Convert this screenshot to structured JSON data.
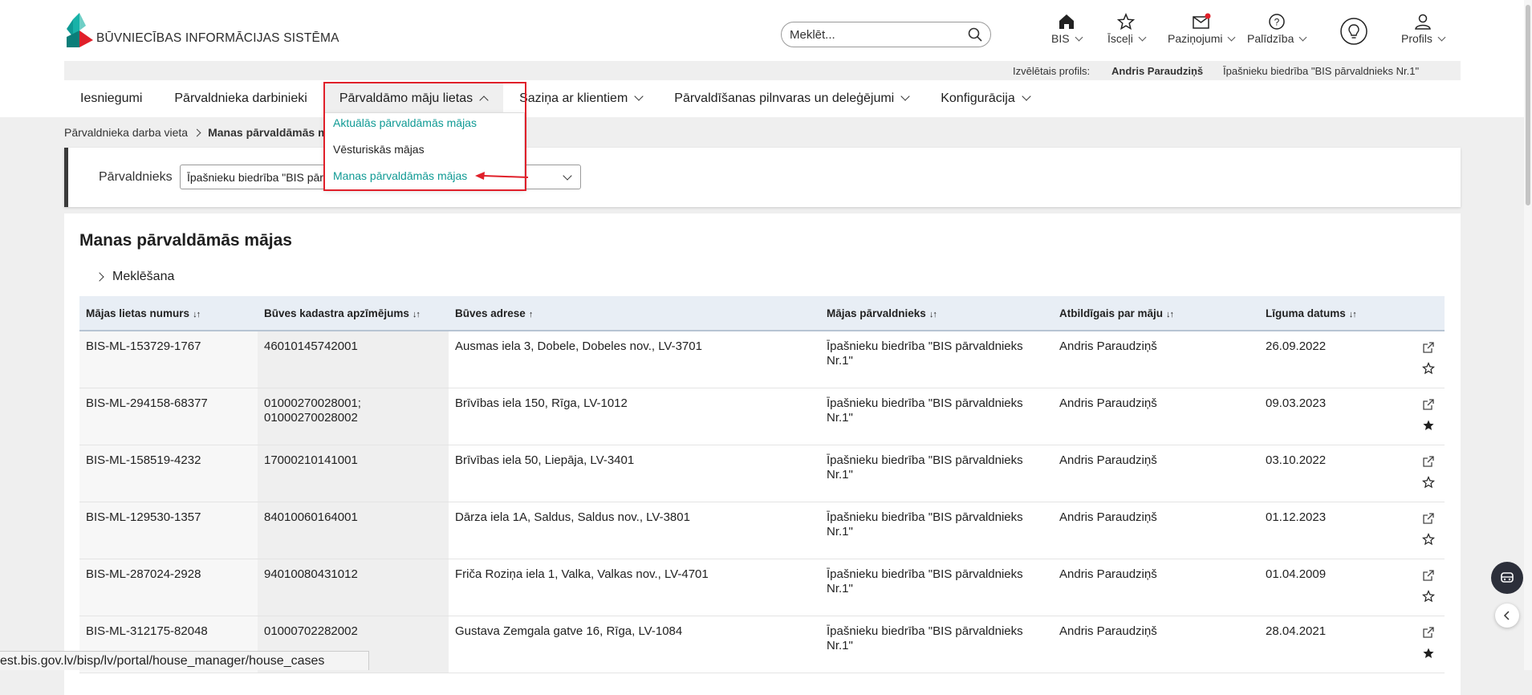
{
  "header": {
    "logo_text": "BŪVNIECĪBAS INFORMĀCIJAS SISTĒMA",
    "search_placeholder": "Meklēt...",
    "icons": [
      {
        "label": "BIS",
        "icon": "home-icon"
      },
      {
        "label": "Īsceļi",
        "icon": "star-icon"
      },
      {
        "label": "Paziņojumi",
        "icon": "envelope-icon"
      },
      {
        "label": "Palīdzība",
        "icon": "question-icon"
      },
      {
        "label": "",
        "icon": "lightbulb-icon"
      },
      {
        "label": "Profils",
        "icon": "user-icon"
      }
    ]
  },
  "profile_bar": {
    "label": "Izvēlētais profils:",
    "name": "Andris Paraudziņš",
    "org": "Īpašnieku biedrība \"BIS pārvaldnieks Nr.1\""
  },
  "nav": {
    "items": [
      "Iesniegumi",
      "Pārvaldnieka darbinieki",
      "Pārvaldāmo māju lietas",
      "Saziņa ar klientiem",
      "Pārvaldīšanas pilnvaras un deleģējumi",
      "Konfigurācija"
    ],
    "dropdown": [
      "Aktuālās pārvaldāmās mājas",
      "Vēsturiskās mājas",
      "Manas pārvaldāmās mājas"
    ]
  },
  "breadcrumb": {
    "parent": "Pārvaldnieka darba vieta",
    "current": "Manas pārvaldāmās m"
  },
  "filter": {
    "label": "Pārvaldnieks",
    "value": "Īpašnieku biedrība \"BIS pārv"
  },
  "main": {
    "title": "Manas pārvaldāmās mājas",
    "search_toggle": "Meklēšana",
    "columns": [
      "Mājas lietas numurs",
      "Būves kadastra apzīmējums",
      "Būves adrese",
      "Mājas pārvaldnieks",
      "Atbildīgais par māju",
      "Līguma datums"
    ],
    "column_sort": [
      "↓↑",
      "↓↑",
      "↑",
      "↓↑",
      "↓↑",
      "↓↑"
    ],
    "rows": [
      {
        "num": "BIS-ML-153729-1767",
        "kad": "46010145742001",
        "addr": "Ausmas iela 3, Dobele, Dobeles nov., LV-3701",
        "mgr": "Īpašnieku biedrība \"BIS pārvaldnieks Nr.1\"",
        "resp": "Andris Paraudziņš",
        "date": "26.09.2022",
        "fav": false
      },
      {
        "num": "BIS-ML-294158-68377",
        "kad": "01000270028001;\n01000270028002",
        "addr": "Brīvības iela 150, Rīga, LV-1012",
        "mgr": "Īpašnieku biedrība \"BIS pārvaldnieks Nr.1\"",
        "resp": "Andris Paraudziņš",
        "date": "09.03.2023",
        "fav": true
      },
      {
        "num": "BIS-ML-158519-4232",
        "kad": "17000210141001",
        "addr": "Brīvības iela 50, Liepāja, LV-3401",
        "mgr": "Īpašnieku biedrība \"BIS pārvaldnieks Nr.1\"",
        "resp": "Andris Paraudziņš",
        "date": "03.10.2022",
        "fav": false
      },
      {
        "num": "BIS-ML-129530-1357",
        "kad": "84010060164001",
        "addr": "Dārza iela 1A, Saldus, Saldus nov., LV-3801",
        "mgr": "Īpašnieku biedrība \"BIS pārvaldnieks Nr.1\"",
        "resp": "Andris Paraudziņš",
        "date": "01.12.2023",
        "fav": false
      },
      {
        "num": "BIS-ML-287024-2928",
        "kad": "94010080431012",
        "addr": "Friča Roziņa iela 1, Valka, Valkas nov., LV-4701",
        "mgr": "Īpašnieku biedrība \"BIS pārvaldnieks Nr.1\"",
        "resp": "Andris Paraudziņš",
        "date": "01.04.2009",
        "fav": false
      },
      {
        "num": "BIS-ML-312175-82048",
        "kad": "01000702282002",
        "addr": "Gustava Zemgala gatve 16, Rīga, LV-1084",
        "mgr": "Īpašnieku biedrība \"BIS pārvaldnieks Nr.1\"",
        "resp": "Andris Paraudziņš",
        "date": "28.04.2021",
        "fav": true
      }
    ]
  },
  "status_url": "est.bis.gov.lv/bisp/lv/portal/house_manager/house_cases",
  "colors": {
    "accent": "#0f9a94",
    "highlight": "#e0202a",
    "header_bg": "#e8eef5",
    "favorite_icon": "#1f1f1f"
  }
}
